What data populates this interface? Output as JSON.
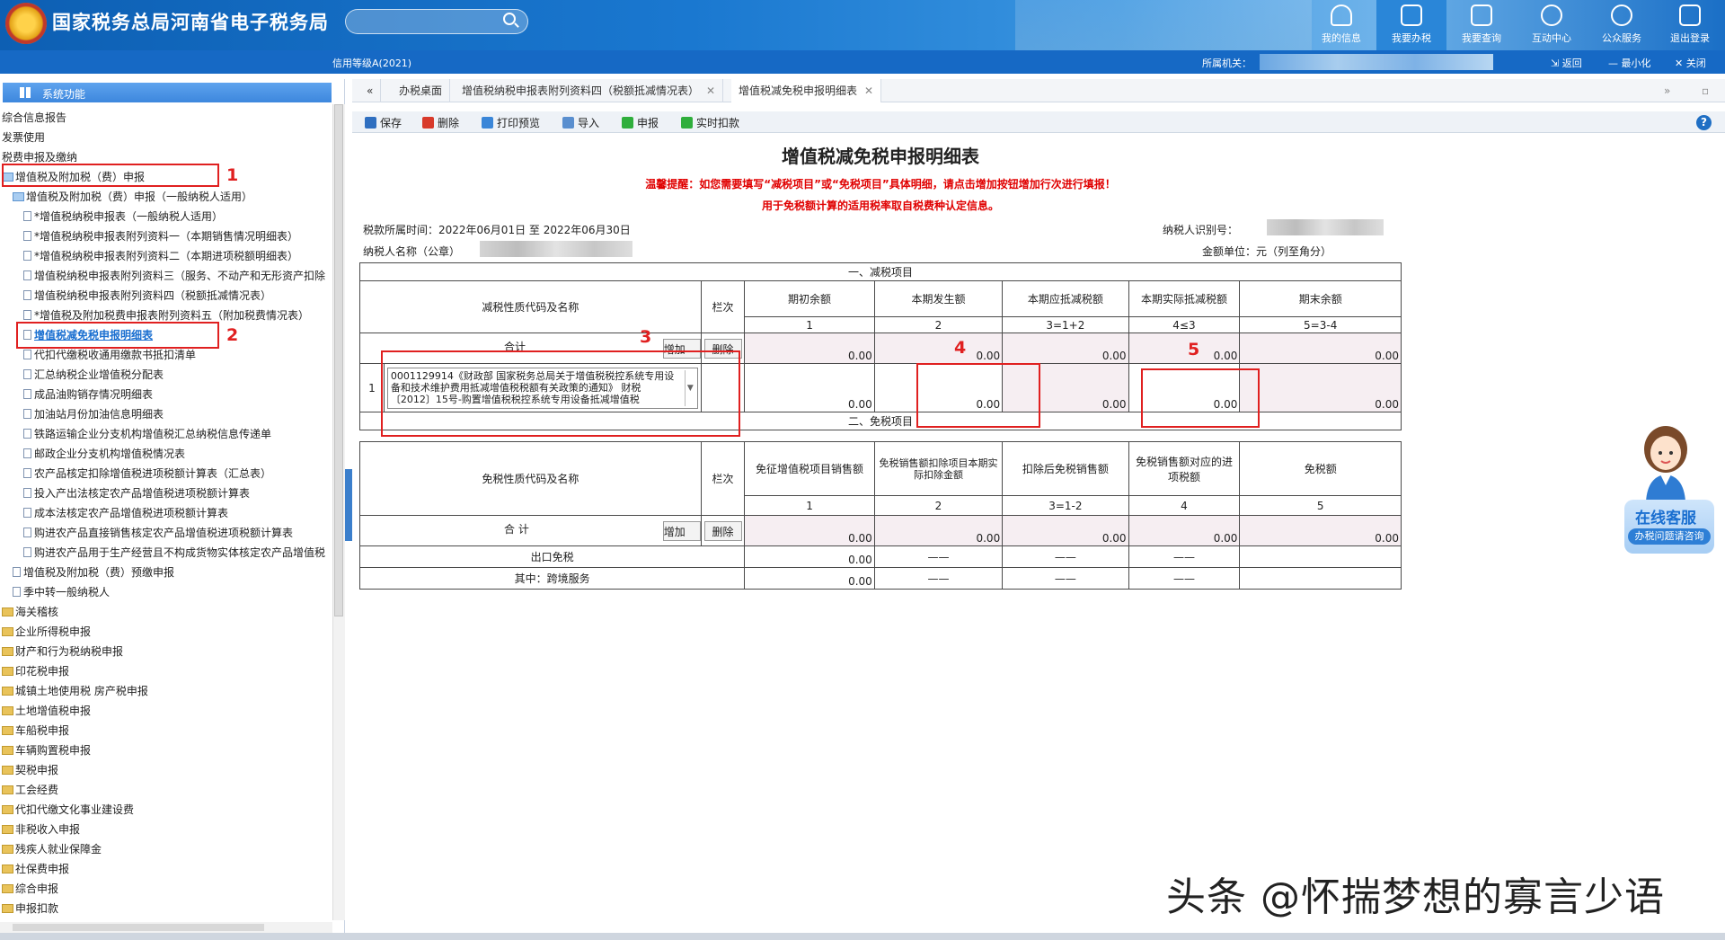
{
  "header": {
    "title": "国家税务总局河南省电子税务局",
    "nav": [
      {
        "label": "我的信息",
        "icon": "user-icon"
      },
      {
        "label": "我要办税",
        "icon": "monitor-icon"
      },
      {
        "label": "我要查询",
        "icon": "search-doc-icon"
      },
      {
        "label": "互动中心",
        "icon": "chat-icon"
      },
      {
        "label": "公众服务",
        "icon": "layers-icon"
      },
      {
        "label": "退出登录",
        "icon": "logout-icon"
      }
    ]
  },
  "subheader": {
    "credit": "信用等级A(2021)",
    "org_label": "所属机关：",
    "back": "返回",
    "minimize": "最小化",
    "close": "关闭"
  },
  "sidebar": {
    "title": "系统功能",
    "items": [
      "综合信息报告",
      "发票使用",
      "税费申报及缴纳",
      "增值税及附加税（费）申报",
      "增值税及附加税（费）申报（一般纳税人适用）",
      "*增值税纳税申报表（一般纳税人适用）",
      "*增值税纳税申报表附列资料一（本期销售情况明细表）",
      "*增值税纳税申报表附列资料二（本期进项税额明细表）",
      "增值税纳税申报表附列资料三（服务、不动产和无形资产扣除",
      "增值税纳税申报表附列资料四（税额抵减情况表）",
      "*增值税及附加税费申报表附列资料五（附加税费情况表）",
      "增值税减免税申报明细表",
      "代扣代缴税收通用缴款书抵扣清单",
      "汇总纳税企业增值税分配表",
      "成品油购销存情况明细表",
      "加油站月份加油信息明细表",
      "铁路运输企业分支机构增值税汇总纳税信息传递单",
      "邮政企业分支机构增值税情况表",
      "农产品核定扣除增值税进项税额计算表（汇总表）",
      "投入产出法核定农产品增值税进项税额计算表",
      "成本法核定农产品增值税进项税额计算表",
      "购进农产品直接销售核定农产品增值税进项税额计算表",
      "购进农产品用于生产经营且不构成货物实体核定农产品增值税",
      "增值税及附加税（费）预缴申报",
      "季中转一般纳税人",
      "海关稽核",
      "企业所得税申报",
      "财产和行为税纳税申报",
      "印花税申报",
      "城镇土地使用税 房产税申报",
      "土地增值税申报",
      "车船税申报",
      "车辆购置税申报",
      "契税申报",
      "工会经费",
      "代扣代缴文化事业建设费",
      "非税收入申报",
      "残疾人就业保障金",
      "社保费申报",
      "综合申报",
      "申报扣款"
    ]
  },
  "tabs": [
    "办税桌面",
    "增值税纳税申报表附列资料四（税额抵减情况表）",
    "增值税减免税申报明细表"
  ],
  "toolbar": {
    "save": "保存",
    "delete": "删除",
    "print": "打印预览",
    "import": "导入",
    "declare": "申报",
    "deduct": "实时扣款"
  },
  "form": {
    "title": "增值税减免税申报明细表",
    "notice1": "温馨提醒：如您需要填写“减税项目”或“免税项目”具体明细，请点击增加按钮增加行次进行填报！",
    "notice2": "用于免税额计算的适用税率取自税费种认定信息。",
    "period": "税款所属时间：2022年06月01日 至 2022年06月30日",
    "taxpayer_id_label": "纳税人识别号：",
    "taxpayer_name_label": "纳税人名称（公章）",
    "unit": "金额单位：元（列至角分）",
    "sec1": "一、减税项目",
    "sec2": "二、免税项目",
    "col_code_name": "减税性质代码及名称",
    "col_line": "栏次",
    "sec1_cols": [
      "期初余额",
      "本期发生额",
      "本期应抵减税额",
      "本期实际抵减税额",
      "期末余额"
    ],
    "sec1_idx": [
      "1",
      "2",
      "3=1+2",
      "4≤3",
      "5=3-4"
    ],
    "total": "合计",
    "total2": "合  计",
    "add": "增加",
    "del": "删除",
    "row_no": "1",
    "row_code": "0001129914《财政部 国家税务总局关于增值税税控系统专用设备和技术维护费用抵减增值税税额有关政策的通知》 财税〔2012〕15号-购置增值税税控系统专用设备抵减增值税",
    "sec1_total_vals": [
      "0.00",
      "0.00",
      "0.00",
      "0.00",
      "0.00"
    ],
    "sec1_row_vals": [
      "0.00",
      "0.00",
      "0.00",
      "0.00",
      "0.00"
    ],
    "col_exempt_code": "免税性质代码及名称",
    "sec2_cols": [
      "免征增值税项目销售额",
      "免税销售额扣除项目本期实际扣除金额",
      "扣除后免税销售额",
      "免税销售额对应的进项税额",
      "免税额"
    ],
    "sec2_idx": [
      "1",
      "2",
      "3=1-2",
      "4",
      "5"
    ],
    "sec2_total_vals": [
      "0.00",
      "0.00",
      "0.00",
      "0.00",
      "0.00"
    ],
    "export_label": "出口免税",
    "export_val": "0.00",
    "cross_label": "其中：跨境服务",
    "cross_val": "0.00",
    "dash": "——"
  },
  "annotations": [
    "1",
    "2",
    "3",
    "4",
    "5"
  ],
  "cs": {
    "title": "在线客服",
    "sub": "办税问题请咨询"
  },
  "watermark": "头条 @怀揣梦想的寡言少语"
}
